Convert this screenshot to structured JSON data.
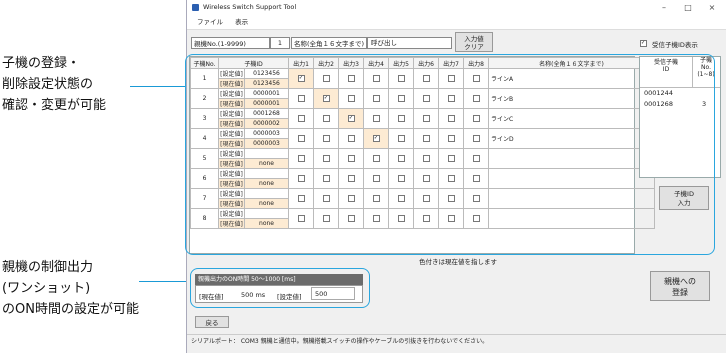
{
  "callouts": {
    "top": "子機の登録・\n削除設定状態の\n確認・変更が可能",
    "bottom": "親機の制御出力\n(ワンショット)\nのON時間の設定が可能"
  },
  "window": {
    "title": "Wireless Switch Support Tool",
    "controls": [
      "–",
      "□",
      "×"
    ],
    "menu": [
      "ファイル",
      "表示"
    ]
  },
  "header": {
    "parent_no_label": "親機No.(1-9999)",
    "parent_no_value": "1",
    "name_label": "名称(全角１６文字まで)",
    "name_value": "呼び出し",
    "clear_button": "入力値\nクリア",
    "show_ids_label": "受信子機ID表示",
    "show_ids_checked": true
  },
  "table": {
    "headers": [
      "子機No.",
      "子機ID",
      "出力1",
      "出力2",
      "出力3",
      "出力4",
      "出力5",
      "出力6",
      "出力7",
      "出力8",
      "名称(全角１６文字まで)"
    ],
    "set_label": "[設定値]",
    "cur_label": "[現在値]",
    "rows": [
      {
        "no": "1",
        "set_id": "0123456",
        "cur_id": "0123456",
        "checked": 1,
        "name": "ラインA"
      },
      {
        "no": "2",
        "set_id": "0000001",
        "cur_id": "0000001",
        "checked": 2,
        "name": "ラインB"
      },
      {
        "no": "3",
        "set_id": "0001268",
        "cur_id": "0000002",
        "checked": 3,
        "name": "ラインC"
      },
      {
        "no": "4",
        "set_id": "0000003",
        "cur_id": "0000003",
        "checked": 4,
        "name": "ラインD"
      },
      {
        "no": "5",
        "set_id": "",
        "cur_id": "none",
        "checked": 0,
        "name": ""
      },
      {
        "no": "6",
        "set_id": "",
        "cur_id": "none",
        "checked": 0,
        "name": ""
      },
      {
        "no": "7",
        "set_id": "",
        "cur_id": "none",
        "checked": 0,
        "name": ""
      },
      {
        "no": "8",
        "set_id": "",
        "cur_id": "none",
        "checked": 0,
        "name": ""
      }
    ],
    "footnote": "色付きは現在値を指します"
  },
  "received": {
    "headers": [
      "受信子機\nID",
      "子機\nNo.\n(1~8)"
    ],
    "rows": [
      {
        "id": "0001244",
        "no": ""
      },
      {
        "id": "0001268",
        "no": "3"
      }
    ],
    "input_button": "子機ID\n入力"
  },
  "on_time": {
    "title": "親機出力のON時間 50～1000 [ms]",
    "cur_label": "[現在値]",
    "cur_value": "500 ms",
    "set_label": "[設定値]",
    "set_value": "500"
  },
  "register_button": "親機への\n登録",
  "back_button": "戻る",
  "status": "シリアルポート： COM3  親機と通信中。親機搭載スイッチの操作やケーブルの引抜きを行わないでください。"
}
